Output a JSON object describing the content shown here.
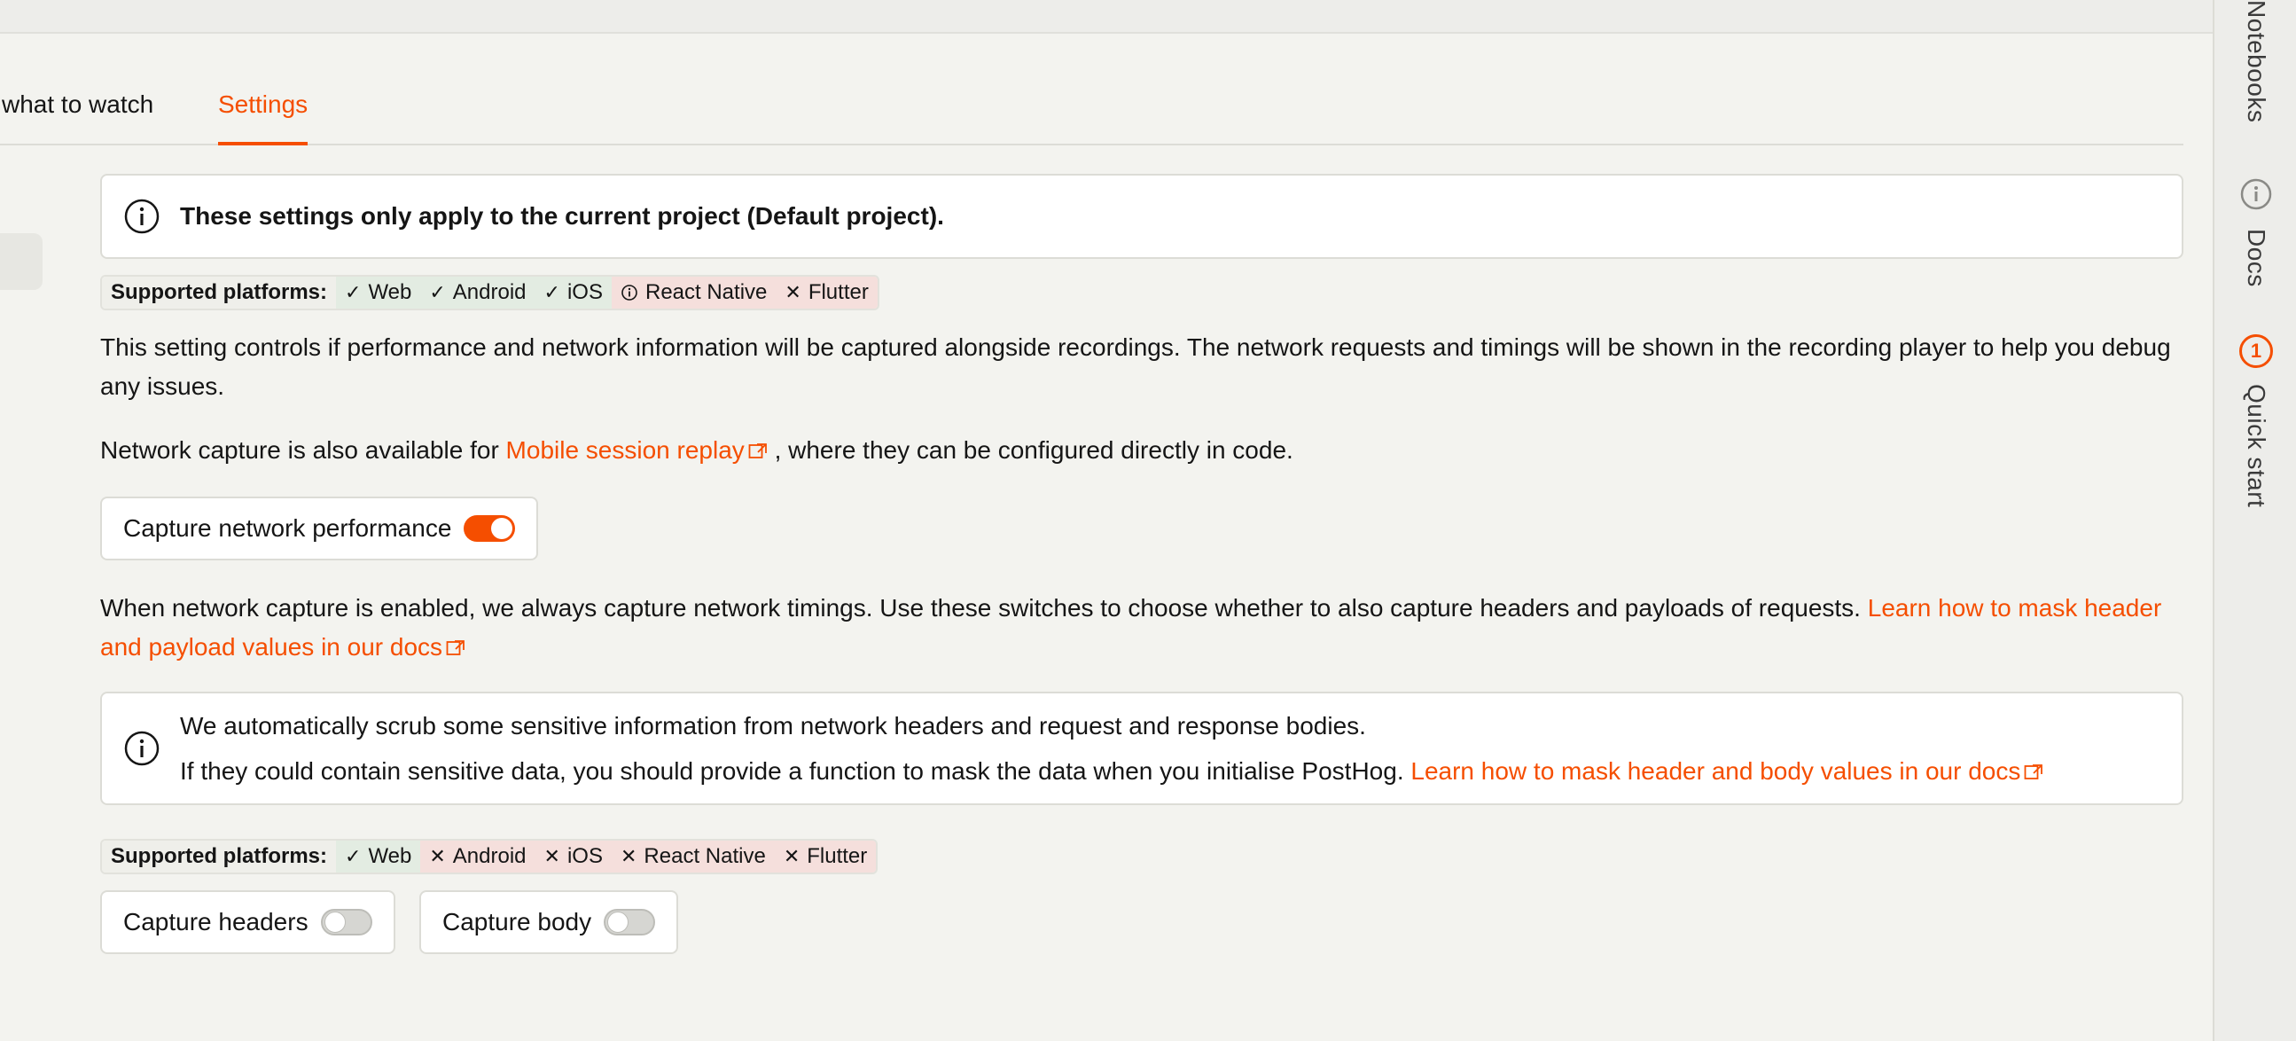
{
  "tabs": [
    {
      "label": "what to watch",
      "active": false
    },
    {
      "label": "Settings",
      "active": true
    }
  ],
  "right_sidebar": {
    "notebooks": "Notebooks",
    "docs": "Docs",
    "quick_start": "Quick start",
    "quick_start_badge": "1"
  },
  "project_notice": {
    "prefix": "These settings only apply to the current project (",
    "project": "Default project",
    "suffix": ")."
  },
  "platforms_1": {
    "label": "Supported platforms:",
    "items": [
      {
        "name": "Web",
        "status": "supported"
      },
      {
        "name": "Android",
        "status": "supported"
      },
      {
        "name": "iOS",
        "status": "supported"
      },
      {
        "name": "React Native",
        "status": "partial"
      },
      {
        "name": "Flutter",
        "status": "unsupported"
      }
    ]
  },
  "description": "This setting controls if performance and network information will be captured alongside recordings. The network requests and timings will be shown in the recording player to help you debug any issues.",
  "mobile_note": {
    "prefix": "Network capture is also available for ",
    "link": "Mobile session replay",
    "suffix": " , where they can be configured directly in code."
  },
  "capture_performance": {
    "label": "Capture network performance",
    "enabled": true
  },
  "timings_note": {
    "text": "When network capture is enabled, we always capture network timings. Use these switches to choose whether to also capture headers and payloads of requests. ",
    "link": "Learn how to mask header and payload values in our docs"
  },
  "scrub_notice": {
    "line1": "We automatically scrub some sensitive information from network headers and request and response bodies.",
    "line2": "If they could contain sensitive data, you should provide a function to mask the data when you initialise PostHog. ",
    "link": "Learn how to mask header and body values in our docs"
  },
  "platforms_2": {
    "label": "Supported platforms:",
    "items": [
      {
        "name": "Web",
        "status": "supported"
      },
      {
        "name": "Android",
        "status": "unsupported"
      },
      {
        "name": "iOS",
        "status": "unsupported"
      },
      {
        "name": "React Native",
        "status": "unsupported"
      },
      {
        "name": "Flutter",
        "status": "unsupported"
      }
    ]
  },
  "capture_headers": {
    "label": "Capture headers",
    "enabled": false
  },
  "capture_body": {
    "label": "Capture body",
    "enabled": false
  },
  "colors": {
    "accent": "#f54e00",
    "supported_bg": "#e3ece2",
    "unsupported_bg": "#f5dfdc"
  },
  "icons": {
    "info": "info-circle-icon",
    "external": "external-link-icon",
    "check": "check-icon",
    "cross": "cross-icon"
  }
}
